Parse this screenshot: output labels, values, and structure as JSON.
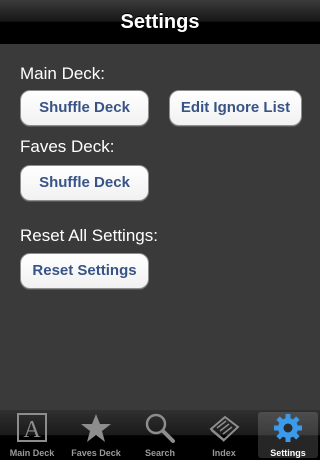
{
  "navbar": {
    "title": "Settings"
  },
  "main_deck": {
    "label": "Main Deck:",
    "shuffle_button": "Shuffle Deck",
    "edit_ignore_button": "Edit Ignore List"
  },
  "faves_deck": {
    "label": "Faves Deck:",
    "shuffle_button": "Shuffle Deck"
  },
  "reset": {
    "label": "Reset All Settings:",
    "reset_button": "Reset Settings"
  },
  "tabbar": {
    "tabs": [
      {
        "label": "Main Deck",
        "icon": "letter-a-icon"
      },
      {
        "label": "Faves Deck",
        "icon": "star-icon"
      },
      {
        "label": "Search",
        "icon": "magnifier-icon"
      },
      {
        "label": "Index",
        "icon": "book-icon"
      },
      {
        "label": "Settings",
        "icon": "gear-icon",
        "selected": true
      }
    ]
  },
  "colors": {
    "background": "#3a3a3a",
    "button_text": "#385487",
    "selected_tab_icon": "#3b9bea"
  }
}
